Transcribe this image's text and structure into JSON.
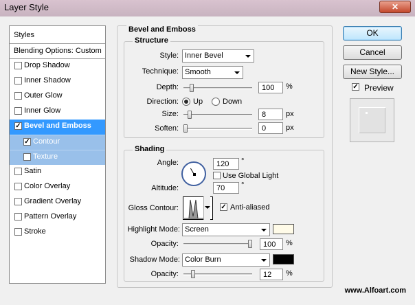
{
  "window": {
    "title": "Layer Style",
    "close_glyph": "✕"
  },
  "styles_panel": {
    "header": "Styles",
    "blending_options": "Blending Options: Custom",
    "items": [
      {
        "label": "Drop Shadow",
        "checked": false
      },
      {
        "label": "Inner Shadow",
        "checked": false
      },
      {
        "label": "Outer Glow",
        "checked": false
      },
      {
        "label": "Inner Glow",
        "checked": false
      },
      {
        "label": "Bevel and Emboss",
        "checked": true
      },
      {
        "label": "Contour",
        "checked": true
      },
      {
        "label": "Texture",
        "checked": false
      },
      {
        "label": "Satin",
        "checked": false
      },
      {
        "label": "Color Overlay",
        "checked": false
      },
      {
        "label": "Gradient Overlay",
        "checked": false
      },
      {
        "label": "Pattern Overlay",
        "checked": false
      },
      {
        "label": "Stroke",
        "checked": false
      }
    ]
  },
  "bevel": {
    "group_title": "Bevel and Emboss",
    "structure": {
      "title": "Structure",
      "style_label": "Style:",
      "style_value": "Inner Bevel",
      "technique_label": "Technique:",
      "technique_value": "Smooth",
      "depth_label": "Depth:",
      "depth_value": "100",
      "depth_fraction": 0.1,
      "depth_unit": "%",
      "direction_label": "Direction:",
      "direction_up": "Up",
      "direction_down": "Down",
      "direction_selected": "Up",
      "size_label": "Size:",
      "size_value": "8",
      "size_fraction": 0.06,
      "size_unit": "px",
      "soften_label": "Soften:",
      "soften_value": "0",
      "soften_fraction": 0.0,
      "soften_unit": "px"
    },
    "shading": {
      "title": "Shading",
      "angle_label": "Angle:",
      "angle_value": "120",
      "angle_unit": "°",
      "use_global_light": "Use Global Light",
      "use_global_light_checked": false,
      "altitude_label": "Altitude:",
      "altitude_value": "70",
      "altitude_unit": "°",
      "gloss_contour_label": "Gloss Contour:",
      "anti_aliased": "Anti-aliased",
      "anti_aliased_checked": true,
      "highlight_mode_label": "Highlight Mode:",
      "highlight_mode_value": "Screen",
      "highlight_color": "#fffbe8",
      "highlight_opacity_label": "Opacity:",
      "highlight_opacity_value": "100",
      "highlight_opacity_fraction": 1.0,
      "highlight_opacity_unit": "%",
      "shadow_mode_label": "Shadow Mode:",
      "shadow_mode_value": "Color Burn",
      "shadow_color": "#000000",
      "shadow_opacity_label": "Opacity:",
      "shadow_opacity_value": "12",
      "shadow_opacity_fraction": 0.12,
      "shadow_opacity_unit": "%"
    }
  },
  "buttons": {
    "ok": "OK",
    "cancel": "Cancel",
    "new_style": "New Style...",
    "preview": "Preview",
    "preview_checked": true
  },
  "watermark": "www.Alfoart.com"
}
